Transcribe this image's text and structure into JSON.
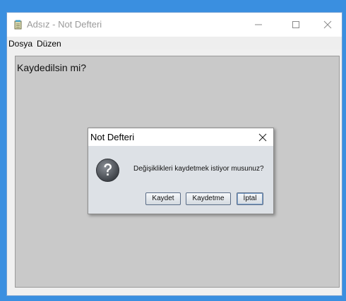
{
  "window": {
    "title": "Adsız - Not Defteri",
    "icons": {
      "app": "notepad-icon",
      "minimize": "minimize-icon",
      "maximize": "maximize-icon",
      "close": "close-icon"
    }
  },
  "menu": {
    "items": [
      {
        "label": "Dosya"
      },
      {
        "label": "Düzen"
      }
    ]
  },
  "editor": {
    "content": "Kaydedilsin mi?"
  },
  "dialog": {
    "title": "Not Defteri",
    "icon": "question-icon",
    "message": "Değişiklikleri kaydetmek istiyor musunuz?",
    "buttons": [
      {
        "label": "Kaydet"
      },
      {
        "label": "Kaydetme"
      },
      {
        "label": "İptal",
        "focused": true
      }
    ]
  },
  "colors": {
    "desktop": "#3a8fe0",
    "editor_background": "#c9c9c9",
    "dialog_background": "#dde1e6"
  }
}
